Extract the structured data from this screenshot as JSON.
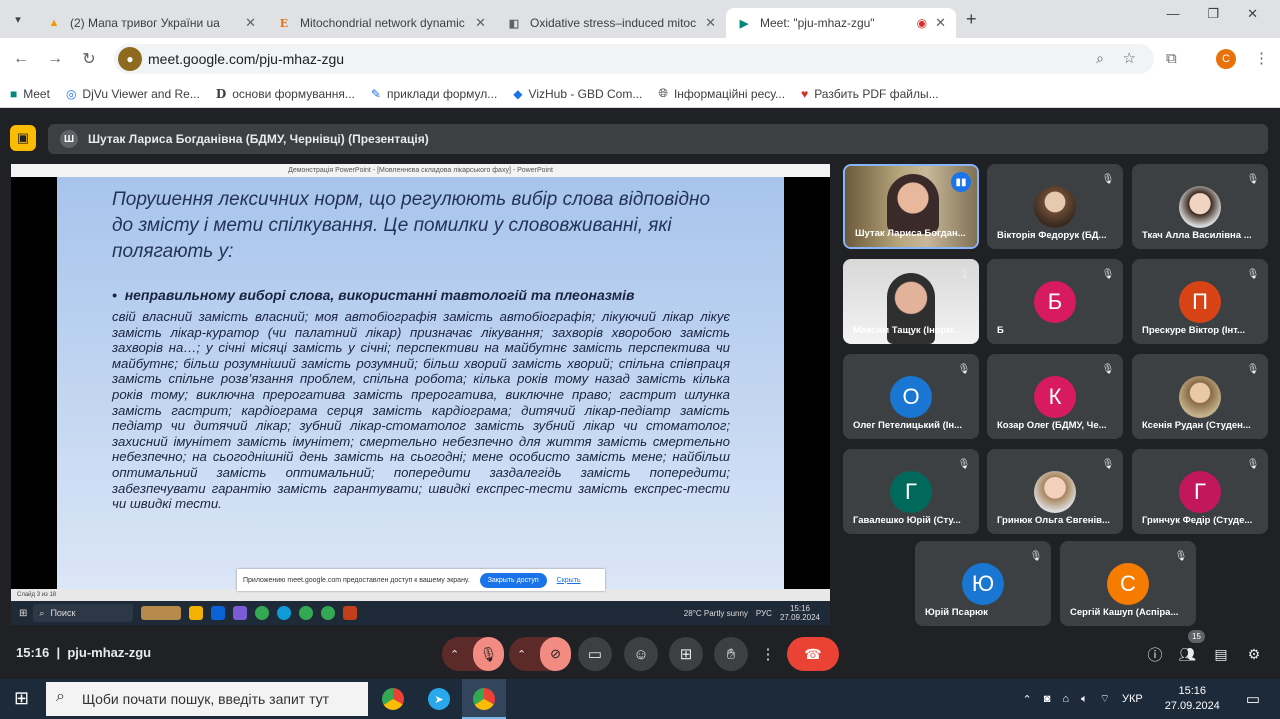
{
  "browser": {
    "tabs": [
      {
        "title": "(2) Мапа тривог України ua",
        "icon": "flame-icon"
      },
      {
        "title": "Mitochondrial network dynamic",
        "icon": "letter-e-icon"
      },
      {
        "title": "Oxidative stress–induced mitoc",
        "icon": "doc-icon"
      },
      {
        "title": "Meet: \"pju-mhaz-zgu\"",
        "icon": "meet-icon",
        "recording": true
      }
    ],
    "url": "meet.google.com/pju-mhaz-zgu",
    "profile_initial": "C",
    "bookmarks": [
      "Meet",
      "DjVu Viewer and Re...",
      "основи формування...",
      "приклади формул...",
      "VizHub - GBD Com...",
      "Інформаційні ресу...",
      "Разбить PDF файлы..."
    ]
  },
  "meet": {
    "presenter_label": "Шутак Лариса Богданівна (БДМУ, Чернівці) (Презентація)",
    "presenter_initial": "Ш",
    "ppt_window_title": "Демонстрація PowerPoint - [Мовленнєва складова лікарського фаху] - PowerPoint",
    "slide": {
      "title": "Порушення лексичних норм, що регулюють вибір слова відповідно до змісту і мети спілкування. Це помилки у слововживанні, які полягають у:",
      "bullet": "неправильному виборі слова, використанні тавтологій та плеоназмів",
      "body": "свій власний замість власний; моя автобіографія замість автобіографія; лікуючий лікар лікує замість лікар-куратор (чи палатний лікар) призначає лікування; захворів хворобою замість захворів на…; у січні місяці замість у січні; перспективи на майбутнє замість перспектива чи майбутнє; більш розумніший замість розумний; більш хворий замість хворий; спільна співпраця замість спільне розв’язання проблем, спільна робота; кілька років тому назад замість кілька років тому; виключна прерогатива замість прерогатива, виключне право; гастрит шлунка замість гастрит; кардіограма серця замість кардіограма; дитячий лікар-педіатр замість педіатр чи дитячий лікар; зубний лікар-стоматолог замість зубний лікар чи стоматолог; захисний імунітет замість імунітет; смертельно небезпечно для життя замість смертельно небезпечно; на сьогоднішній день замість на сьогодні; мене особисто замість мене; найбільш оптимальний замість оптимальний; попередити заздалегідь замість попередити; забезпечувати гарантію замість гарантувати; швидкі експрес-тести замість експрес-тести чи швидкі тести."
    },
    "slide_status": "Слайд 3 из 18",
    "notification": {
      "text": "Приложению meet.google.com предоставлен доступ к вашему экрану.",
      "button": "Закрыть доступ",
      "link": "Скрыть"
    },
    "inner_taskbar": {
      "search": "Поиск",
      "weather": "28°C  Partly sunny",
      "lang": "РУС",
      "time": "15:16",
      "date": "27.09.2024"
    },
    "participants": [
      {
        "name": "Шутак Лариса Богдан...",
        "type": "video",
        "speaking": true
      },
      {
        "name": "Вікторія Федорук (БД...",
        "type": "photo"
      },
      {
        "name": "Ткач Алла Василівна ...",
        "type": "photo"
      },
      {
        "name": "Максим Тащук (Інорм...",
        "type": "video"
      },
      {
        "name": "Б",
        "initial": "Б",
        "color": "#d81b60"
      },
      {
        "name": "Прескуре Віктор (Інт...",
        "initial": "П",
        "color": "#d84315"
      },
      {
        "name": "Олег Петелицький (Ін...",
        "initial": "О",
        "color": "#1976d2"
      },
      {
        "name": "Козар Олег (БДМУ, Че...",
        "initial": "К",
        "color": "#d81b60"
      },
      {
        "name": "Ксенія Рудан (Студен...",
        "type": "photo"
      },
      {
        "name": "Гавалешко Юрій (Сту...",
        "initial": "Г",
        "color": "#00695c"
      },
      {
        "name": "Гринюк Ольга Євгенів...",
        "type": "photo"
      },
      {
        "name": "Гринчук Федір (Студе...",
        "initial": "Г",
        "color": "#c2185b"
      },
      {
        "name": "Юрій Псарюк",
        "initial": "Ю",
        "color": "#1976d2"
      },
      {
        "name": "Сергій Кашуп (Аспіра...",
        "initial": "С",
        "color": "#f57c00"
      }
    ],
    "time": "15:16",
    "meeting_code": "pju-mhaz-zgu",
    "participant_count": "15",
    "end_call_color": "#ea4335"
  },
  "taskbar": {
    "search_placeholder": "Щоби почати пошук, введіть запит тут",
    "lang": "УКР",
    "time": "15:16",
    "date": "27.09.2024"
  }
}
